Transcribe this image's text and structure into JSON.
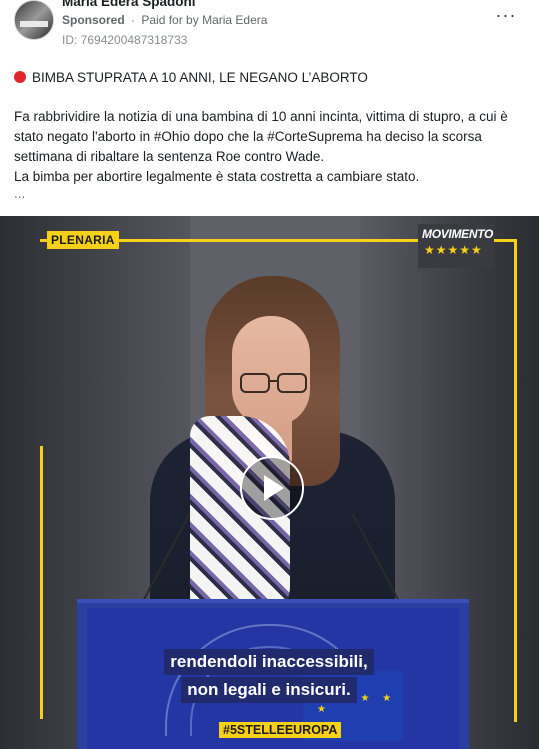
{
  "header": {
    "page_name": "Maria Edera Spadoni",
    "sponsored_label": "Sponsored",
    "separator": "·",
    "paid_for_prefix": "Paid for by",
    "paid_for_name": "Maria Edera",
    "ad_id": "ID: 7694200487318733",
    "more_options_icon": "more-horizontal-icon"
  },
  "post": {
    "headline_icon": "red-circle-icon",
    "headline": "BIMBA STUPRATA A 10 ANNI, LE NEGANO L’ABORTO",
    "paragraph_1": "Fa rabbrividire la notizia di una bambina di 10 anni incinta, vittima di stupro, a cui è stato negato l'aborto in #Ohio dopo che la #CorteSuprema ha deciso la scorsa settimana di ribaltare la sentenza Roe contro Wade.",
    "paragraph_2": "La bimba per abortire legalmente è stata costretta a cambiare stato.",
    "ellipsis": "..."
  },
  "video": {
    "badge_left": "PLENARIA",
    "logo_word": "MOVIMENTO",
    "logo_stars": "★★★★★",
    "subtitle_line_1": "rendendoli inaccessibili,",
    "subtitle_line_2": "non legali e insicuri.",
    "hashtag": "#5STELLEEUROPA",
    "eu_stars": "★ ★ ★ ★ ★",
    "play_icon": "play-icon",
    "accent_color": "#f7d117"
  }
}
